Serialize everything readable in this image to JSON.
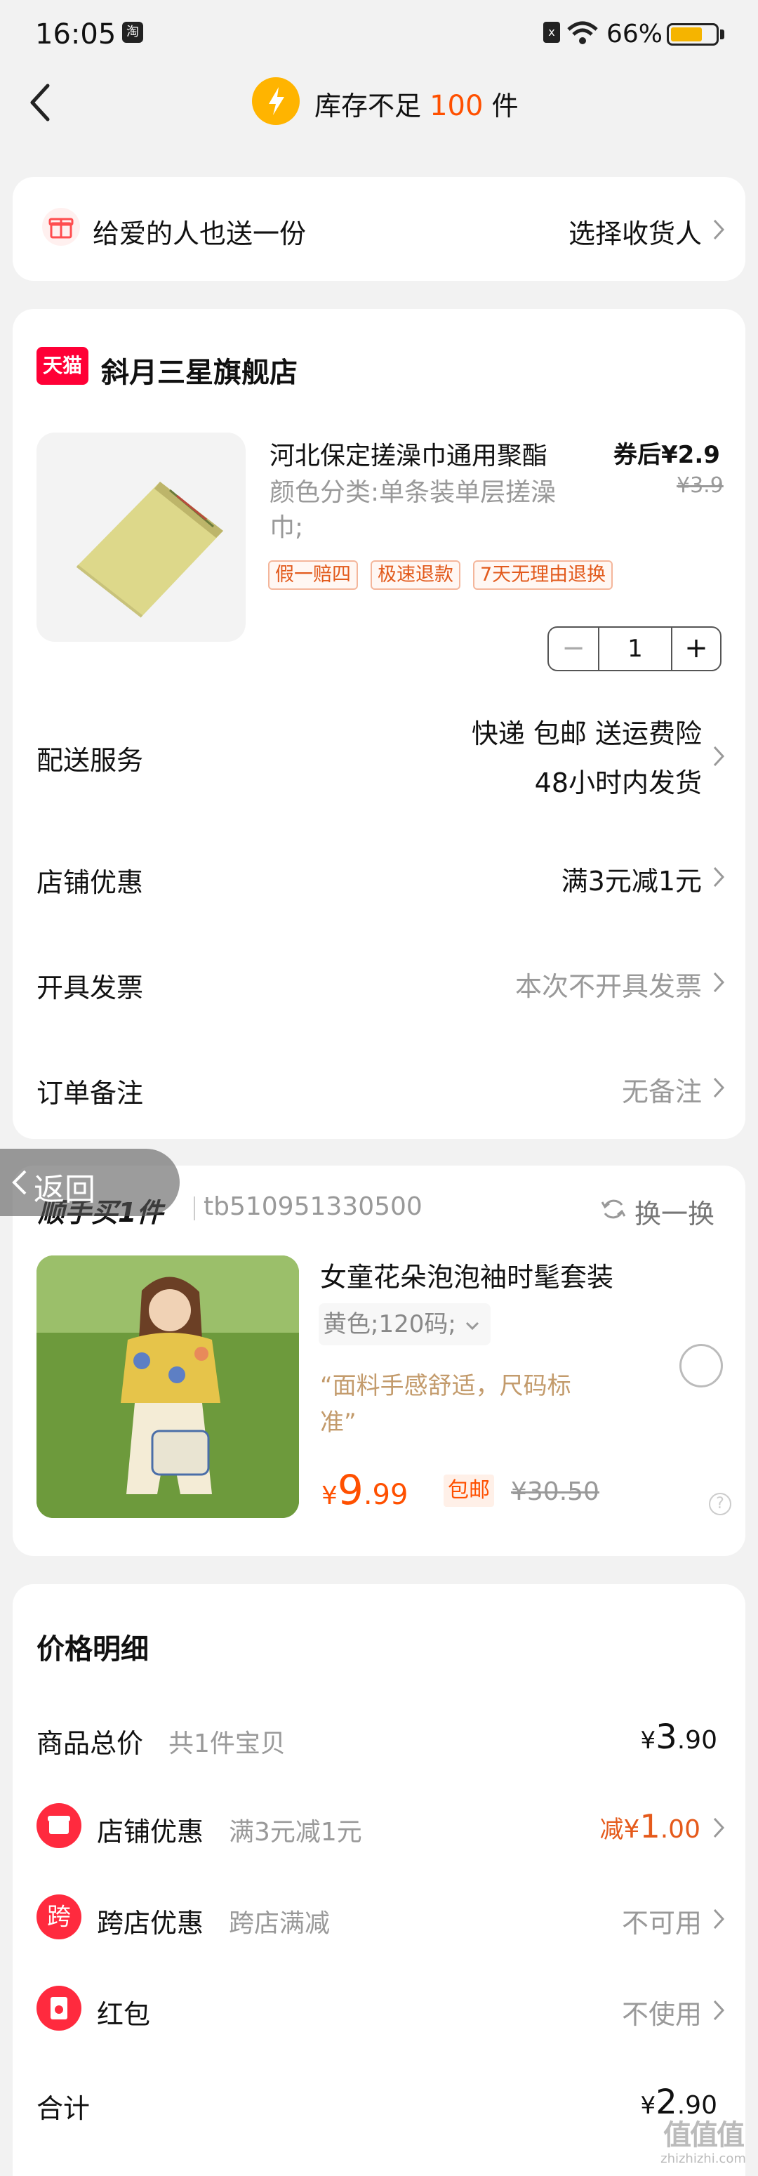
{
  "status": {
    "time": "16:05",
    "app_badge": "淘",
    "sim": "x",
    "battery": "66%"
  },
  "header": {
    "stock_prefix": "库存不足",
    "stock_count": "100",
    "stock_suffix": "件"
  },
  "gift": {
    "label": "给爱的人也送一份",
    "action": "选择收货人"
  },
  "shop": {
    "badge": "天猫",
    "name": "斜月三星旗舰店",
    "product": {
      "title": "河北保定搓澡巾通用聚酯",
      "variant_line1": "颜色分类:单条装单层搓澡",
      "variant_line2": "巾;",
      "tags": [
        "假一赔四",
        "极速退款",
        "7天无理由退换"
      ],
      "price_after_coupon": "券后¥2.9",
      "original_price": "¥3.9",
      "quantity": "1",
      "minus": "−",
      "plus": "+"
    },
    "rows": [
      {
        "label": "配送服务",
        "value_line1": "快递 包邮 送运费险",
        "value_line2": "48小时内发货"
      },
      {
        "label": "店铺优惠",
        "value": "满3元减1元"
      },
      {
        "label": "开具发票",
        "value": "本次不开具发票"
      },
      {
        "label": "订单备注",
        "value": "无备注"
      }
    ]
  },
  "float_back": {
    "label": "返回"
  },
  "addon": {
    "title": "顺手买1件",
    "id": "tb510951330500",
    "refresh": "换一换",
    "product_title": "女童花朵泡泡袖时髦套装",
    "variant": "黄色;120码;",
    "quote_line1": "“面料手感舒适，尺码标",
    "quote_line2": "准”",
    "price_symbol": "¥",
    "price_int": "9",
    "price_dec": ".99",
    "free_ship": "包邮",
    "original_price": "¥30.50"
  },
  "price_detail": {
    "title": "价格明细",
    "total_label": "商品总价",
    "total_sub": "共1件宝贝",
    "total_symbol": "¥",
    "total_int": "3",
    "total_dec": ".90",
    "shop_discount_label": "店铺优惠",
    "shop_discount_sub": "满3元减1元",
    "shop_discount_prefix": "减",
    "shop_discount_symbol": "¥",
    "shop_discount_int": "1",
    "shop_discount_dec": ".00",
    "cross_label": "跨店优惠",
    "cross_sub": "跨店满减",
    "cross_value": "不可用",
    "cross_icon_text": "跨",
    "redpack_label": "红包",
    "redpack_value": "不使用",
    "sum_label": "合计",
    "sum_symbol": "¥",
    "sum_int": "2",
    "sum_dec": ".90"
  },
  "watermark": {
    "text": "值值值",
    "sub": "zhizhizhi.com"
  },
  "colors": {
    "accent": "#ff5000",
    "price_orange": "#e55a1b",
    "tmall_red": "#ff0036",
    "gray_text": "#999999",
    "bg": "#f2f2f2"
  }
}
